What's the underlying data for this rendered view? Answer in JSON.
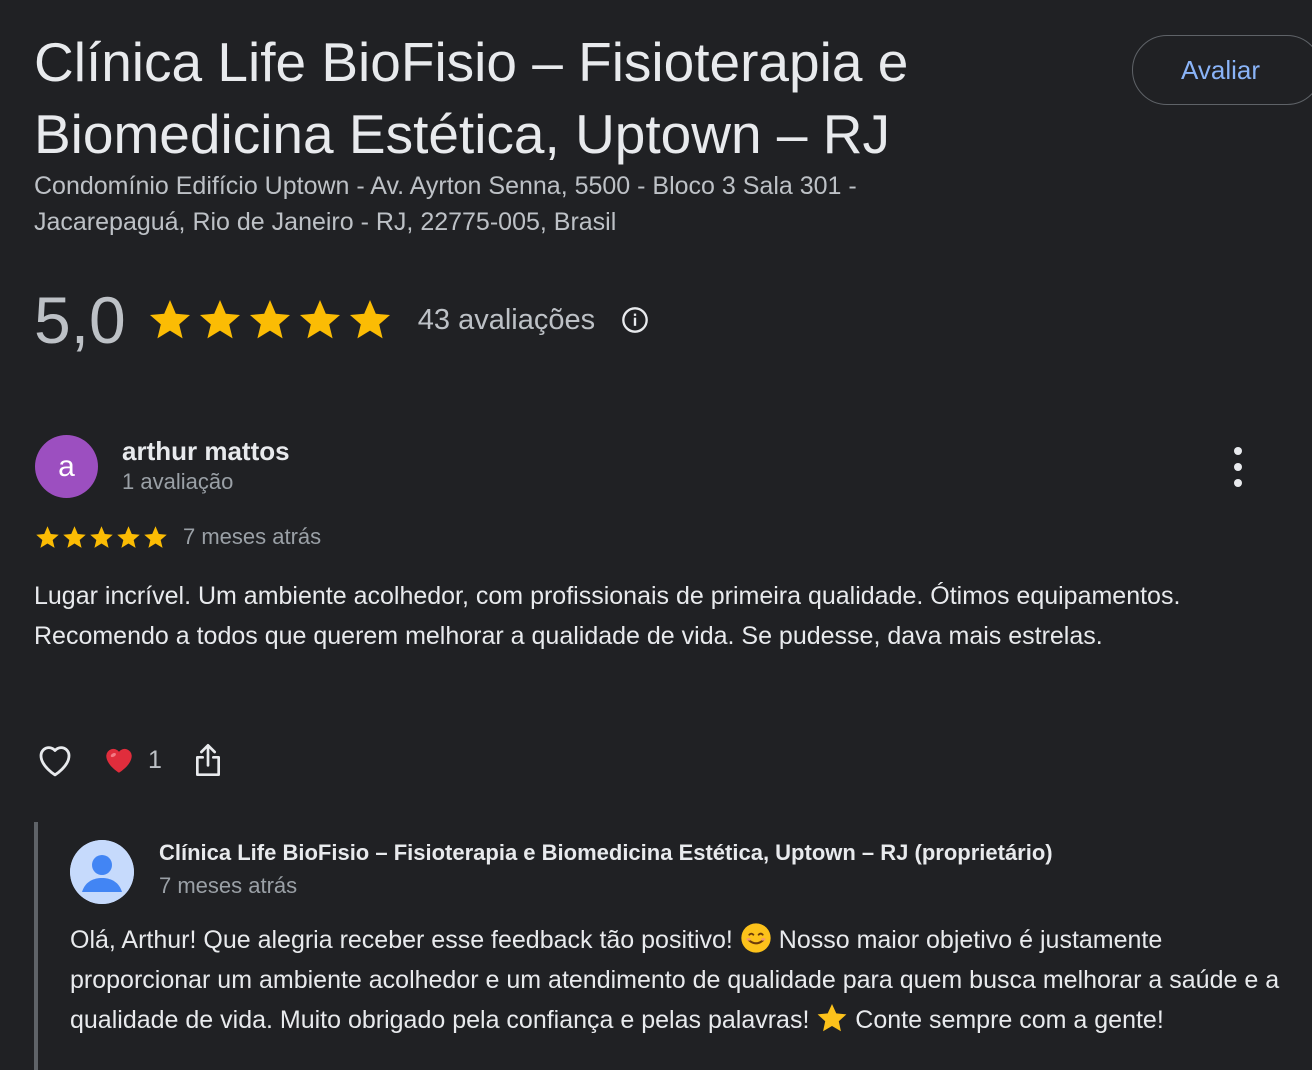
{
  "place": {
    "title": "Clínica Life BioFisio – Fisioterapia e Biomedicina Estética, Uptown – RJ",
    "address": "Condomínio Edifício Uptown - Av. Ayrton Senna, 5500 - Bloco 3 Sala 301 - Jacarepaguá, Rio de Janeiro - RJ, 22775-005, Brasil",
    "rate_button_label": "Avaliar"
  },
  "summary": {
    "rating": "5,0",
    "stars": 5,
    "review_count_label": "43 avaliações"
  },
  "review": {
    "avatar_letter": "a",
    "avatar_color": "#9c4fc0",
    "author": "arthur mattos",
    "author_meta": "1 avaliação",
    "stars": 5,
    "time": "7 meses atrás",
    "text": "Lugar incrível. Um ambiente acolhedor, com profissionais de primeira qualidade. Ótimos equipamentos. Recomendo a todos que querem melhorar a qualidade de vida. Se pudesse, dava mais estrelas.",
    "reaction_count": "1"
  },
  "owner_reply": {
    "name": "Clínica Life BioFisio – Fisioterapia e Biomedicina Estética, Uptown – RJ (proprietário)",
    "time": "7 meses atrás",
    "text_part1": "Olá, Arthur! Que alegria receber esse feedback tão positivo! ",
    "text_part2": " Nosso maior objetivo é justamente proporcionar um ambiente acolhedor e um atendimento de qualidade para quem busca melhorar a saúde e a qualidade de vida. Muito obrigado pela confiança e pelas palavras! ",
    "text_part3": " Conte sempre com a gente!"
  },
  "colors": {
    "background": "#202124",
    "star": "#fbbc04",
    "link": "#8ab4f8",
    "heart": "#e02d3c"
  },
  "icons": {
    "info": "info-icon",
    "more": "more-vert-icon",
    "like": "heart-outline-icon",
    "reaction": "heart-emoji-icon",
    "share": "share-icon",
    "smile": "smile-emoji-icon",
    "star_emoji": "star-emoji-icon"
  }
}
